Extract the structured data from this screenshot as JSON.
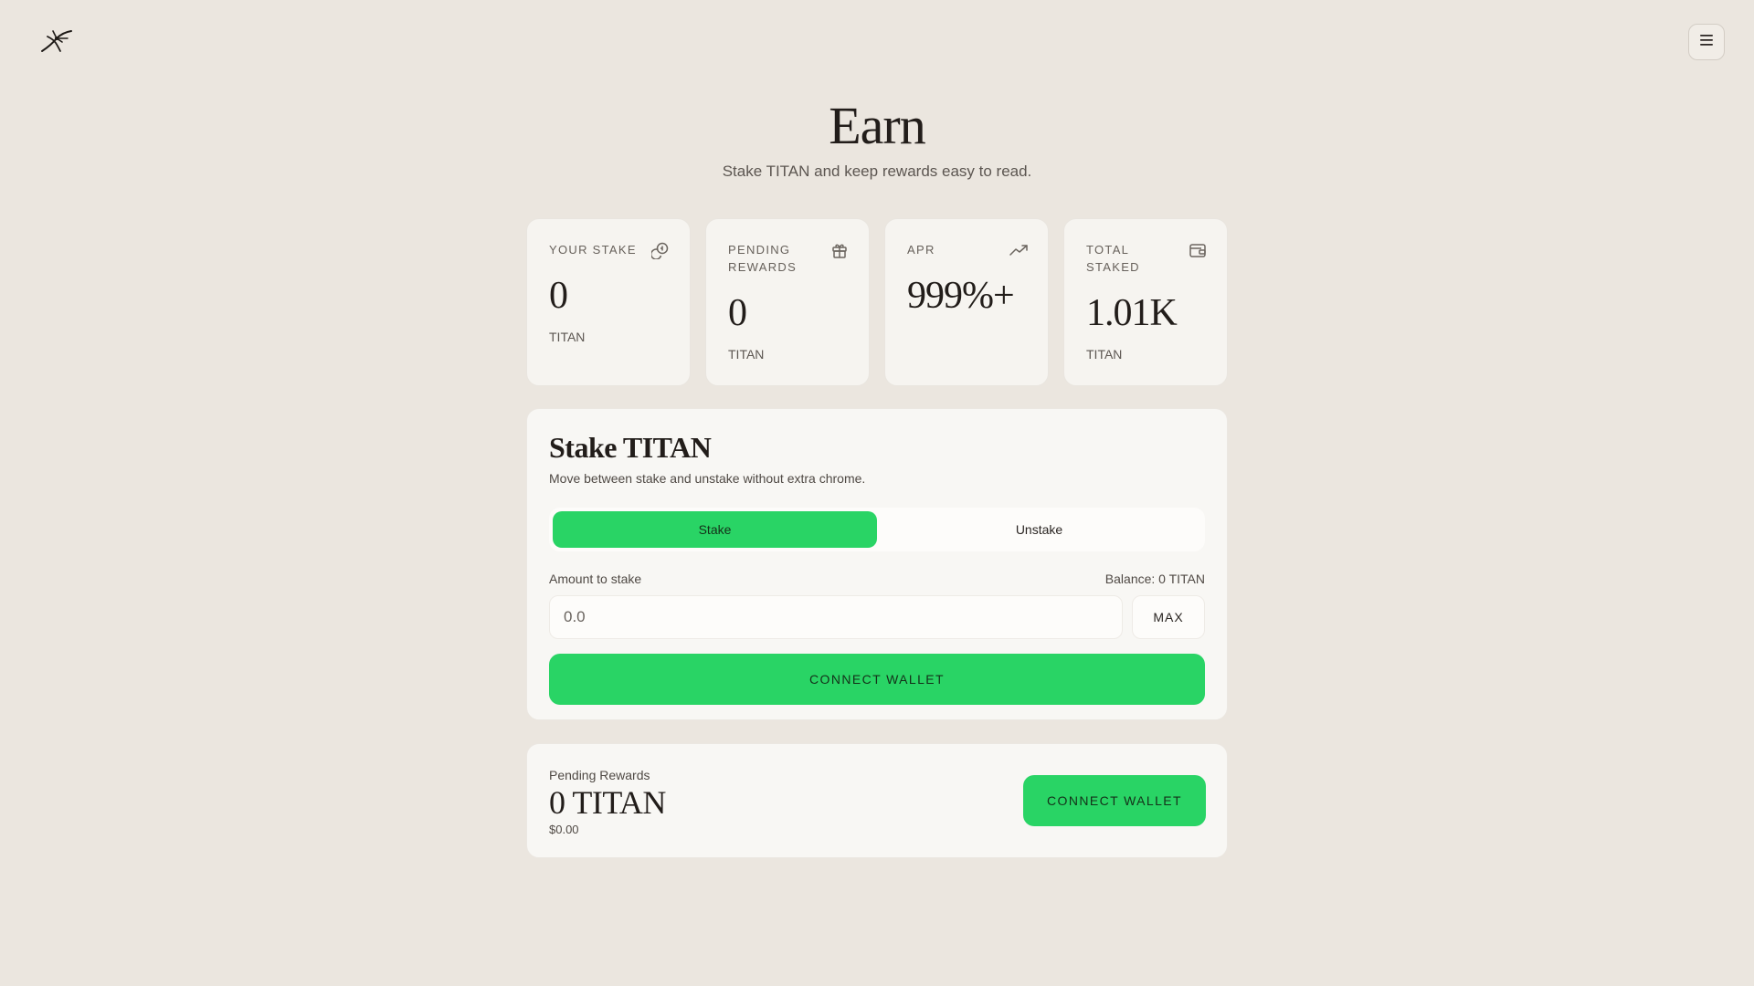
{
  "header": {
    "logo_icon": "bird-logo-icon",
    "menu_icon": "hamburger-menu-icon",
    "menu_glyph": "☰"
  },
  "hero": {
    "title": "Earn",
    "subtitle": "Stake TITAN and keep rewards easy to read."
  },
  "stats": [
    {
      "label": "YOUR STAKE",
      "value": "0",
      "unit": "TITAN",
      "icon": "coins-icon"
    },
    {
      "label": "PENDING REWARDS",
      "value": "0",
      "unit": "TITAN",
      "icon": "gift-icon"
    },
    {
      "label": "APR",
      "value": "999%+",
      "unit": "",
      "icon": "trending-up-icon"
    },
    {
      "label": "TOTAL STAKED",
      "value": "1.01K",
      "unit": "TITAN",
      "icon": "wallet-icon"
    }
  ],
  "stake_panel": {
    "title": "Stake TITAN",
    "subtitle": "Move between stake and unstake without extra chrome.",
    "tabs": [
      {
        "label": "Stake",
        "active": true
      },
      {
        "label": "Unstake",
        "active": false
      }
    ],
    "amount_label": "Amount to stake",
    "balance_text": "Balance: 0 TITAN",
    "amount_placeholder": "0.0",
    "max_label": "MAX",
    "connect_label": "CONNECT WALLET"
  },
  "rewards_panel": {
    "label": "Pending Rewards",
    "value": "0 TITAN",
    "usd": "$0.00",
    "connect_label": "CONNECT WALLET"
  },
  "colors": {
    "background": "#ebe6df",
    "card": "#f6f4f0",
    "accent_green": "#29d465",
    "text_dark": "#221d1a"
  }
}
